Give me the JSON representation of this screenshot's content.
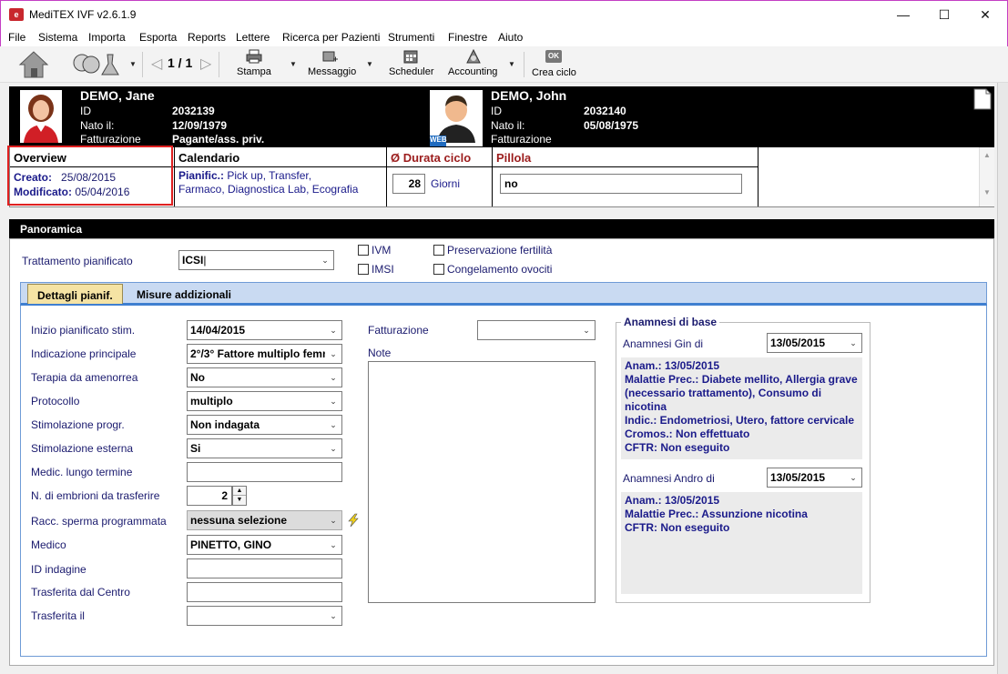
{
  "window": {
    "title": "MediTEX IVF v2.6.1.9",
    "icon_text": "e"
  },
  "menu": [
    "File",
    "Sistema",
    "Importa",
    "Esporta",
    "Reports",
    "Lettere",
    "Ricerca per Pazienti",
    "Strumenti",
    "Finestre",
    "Aiuto"
  ],
  "toolbar": {
    "page_indicator": "1 / 1",
    "stampa": "Stampa",
    "messaggio": "Messaggio",
    "scheduler": "Scheduler",
    "accounting": "Accounting",
    "crea_ciclo": "Crea ciclo",
    "ok_icon": "OK"
  },
  "patient_female": {
    "name": "DEMO, Jane",
    "id_label": "ID",
    "id": "2032139",
    "born_label": "Nato il:",
    "born": "12/09/1979",
    "billing_label": "Fatturazione",
    "billing": "Pagante/ass. priv."
  },
  "patient_male": {
    "name": "DEMO, John",
    "id_label": "ID",
    "id": "2032140",
    "born_label": "Nato il:",
    "born": "05/08/1975",
    "billing_label": "Fatturazione",
    "badge": "WEB"
  },
  "strip": {
    "overview_title": "Overview",
    "created_label": "Creato:",
    "created": "25/08/2015",
    "modified_label": "Modificato:",
    "modified": "05/04/2016",
    "calendar_title": "Calendario",
    "plan_label": "Pianific.:",
    "plan_text_1": "Pick up, Transfer,",
    "plan_text_2": "Farmaco, Diagnostica Lab, Ecografia",
    "duration_title": "Ø Durata ciclo",
    "duration_value": "28",
    "duration_unit": "Giorni",
    "pill_title": "Pillola",
    "pill_value": "no"
  },
  "panel": {
    "title": "Panoramica",
    "treatment_label": "Trattamento pianificato",
    "treatment_value": "ICSI",
    "cb_ivm": "IVM",
    "cb_imsi": "IMSI",
    "cb_fertility": "Preservazione fertilità",
    "cb_oocytes": "Congelamento ovociti",
    "tab_details": "Dettagli pianif.",
    "tab_measures": "Misure addizionali"
  },
  "form": {
    "inizio_label": "Inizio pianificato stim.",
    "inizio_value": "14/04/2015",
    "indicazione_label": "Indicazione principale",
    "indicazione_value": "2°/3° Fattore multiplo femn",
    "terapia_label": "Terapia da amenorrea",
    "terapia_value": "No",
    "protocollo_label": "Protocollo",
    "protocollo_value": "multiplo",
    "stim_progr_label": "Stimolazione progr.",
    "stim_progr_value": "Non indagata",
    "stim_est_label": "Stimolazione esterna",
    "stim_est_value": "Si",
    "medic_label": "Medic. lungo termine",
    "medic_value": "",
    "embrioni_label": "N. di embrioni da trasferire",
    "embrioni_value": "2",
    "racc_label": "Racc. sperma programmata",
    "racc_value": "nessuna selezione",
    "medico_label": "Medico",
    "medico_value": "PINETTO, GINO",
    "id_indagine_label": "ID indagine",
    "trasferita_centro_label": "Trasferita dal Centro",
    "trasferita_il_label": "Trasferita il",
    "fatturazione_label": "Fatturazione",
    "note_label": "Note"
  },
  "anamnesi": {
    "group_title": "Anamnesi di base",
    "gin_label": "Anamnesi Gin di",
    "gin_date": "13/05/2015",
    "gin_text": [
      "Anam.: 13/05/2015",
      "Malattie Prec.: Diabete mellito, Allergia grave",
      "(necessario trattamento), Consumo di",
      "nicotina",
      "Indic.: Endometriosi, Utero, fattore cervicale",
      "Cromos.: Non effettuato",
      "CFTR: Non eseguito"
    ],
    "andro_label": "Anamnesi Andro di",
    "andro_date": "13/05/2015",
    "andro_text": [
      "Anam.: 13/05/2015",
      "Malattie Prec.: Assunzione nicotina",
      "CFTR: Non eseguito"
    ]
  },
  "colors": {
    "highlight": "#e02020",
    "label_blue": "#1a1a6e",
    "strip_red": "#9b1c1c",
    "tab_active": "#f5e3a4",
    "tab_strip": "#3f7fd0"
  }
}
